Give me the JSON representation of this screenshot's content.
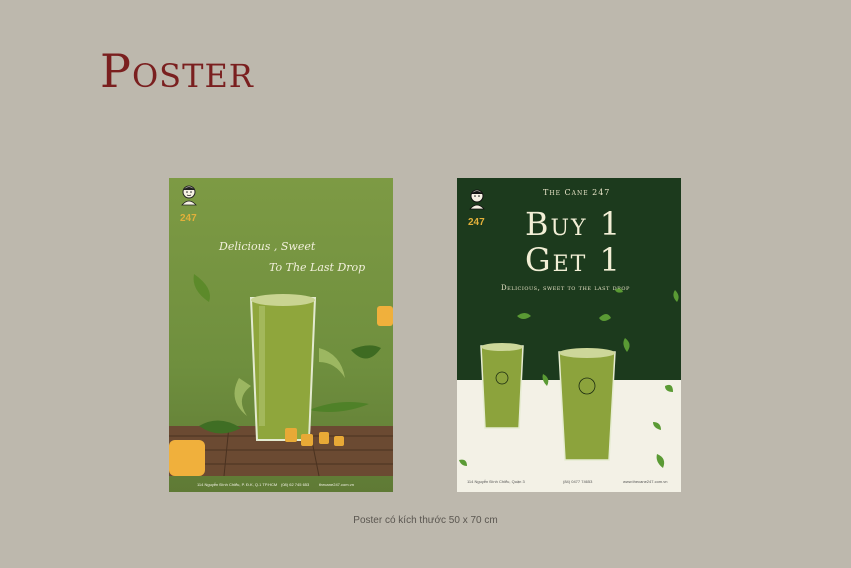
{
  "page": {
    "title": "Poster",
    "caption": "Poster có kích thước 50 x 70 cm"
  },
  "poster_left": {
    "logo_number": "247",
    "tagline_line1": "Delicious , Sweet",
    "tagline_line2": "To The Last Drop",
    "footer_address": "114 Nguyễn Đình Chiểu, P. Đ.K, Q.1 TP.HCM",
    "footer_phone": "(08) 62 745 653",
    "footer_web": "thecane247.com.vn"
  },
  "poster_right": {
    "logo_number": "247",
    "brand": "The Cane 247",
    "offer_line1": "Buy 1",
    "offer_line2": "Get 1",
    "subtitle": "Delicious, sweet to the last drop",
    "footer_address": "114 Nguyễn Đình Chiểu, Quận 3",
    "footer_phone": "(84) 0477 74653",
    "footer_web": "www.thecane247.com.vn"
  },
  "colors": {
    "background": "#bdb8ad",
    "title": "#7a1f1f",
    "left_poster": "#7d9a44",
    "right_poster": "#1c3a1d",
    "cream": "#f3f1e6"
  }
}
